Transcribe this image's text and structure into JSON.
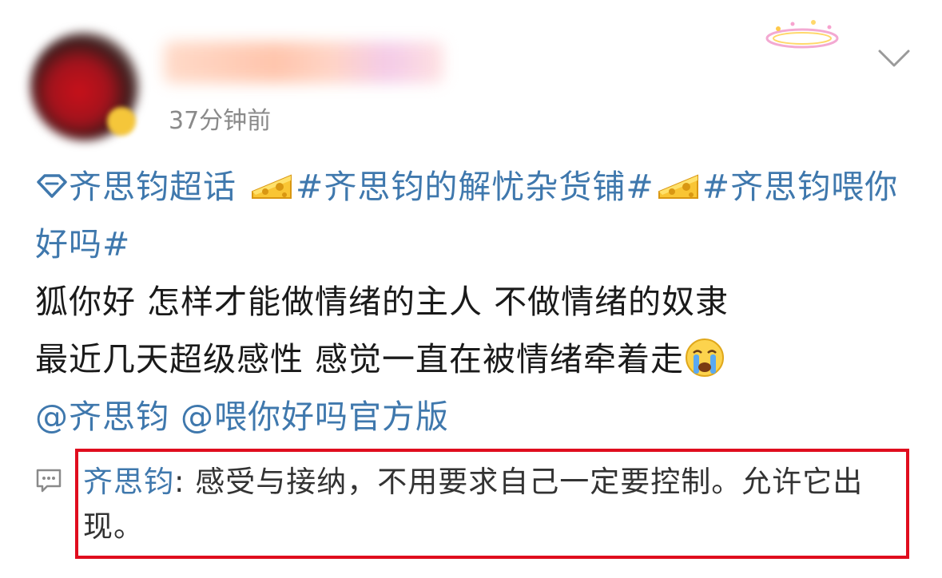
{
  "post": {
    "time": "37分钟前",
    "topic": "齐思钧超话",
    "hashtag1": "#齐思钧的解忧杂货铺#",
    "hashtag2": "#齐思钧喂你好吗#",
    "line1": "狐你好 怎样才能做情绪的主人 不做情绪的奴隶",
    "line2": "最近几天超级感性 感觉一直在被情绪牵着走",
    "mention1": "@齐思钧",
    "mention2": "@喂你好吗官方版"
  },
  "comment": {
    "author": "齐思钧",
    "text": ": 感受与接纳，不用要求自己一定要控制。允许它出现。"
  },
  "icons": {
    "topic": "super-topic-diamond-icon",
    "cheese": "cheese-emoji",
    "cry": "crying-face-emoji",
    "comment": "comment-bubble-icon",
    "dropdown": "chevron-down-icon"
  },
  "colors": {
    "link": "#3f78ad",
    "text": "#1a1a1a",
    "muted": "#8a8a8a",
    "highlight_box": "#e00d1e"
  }
}
